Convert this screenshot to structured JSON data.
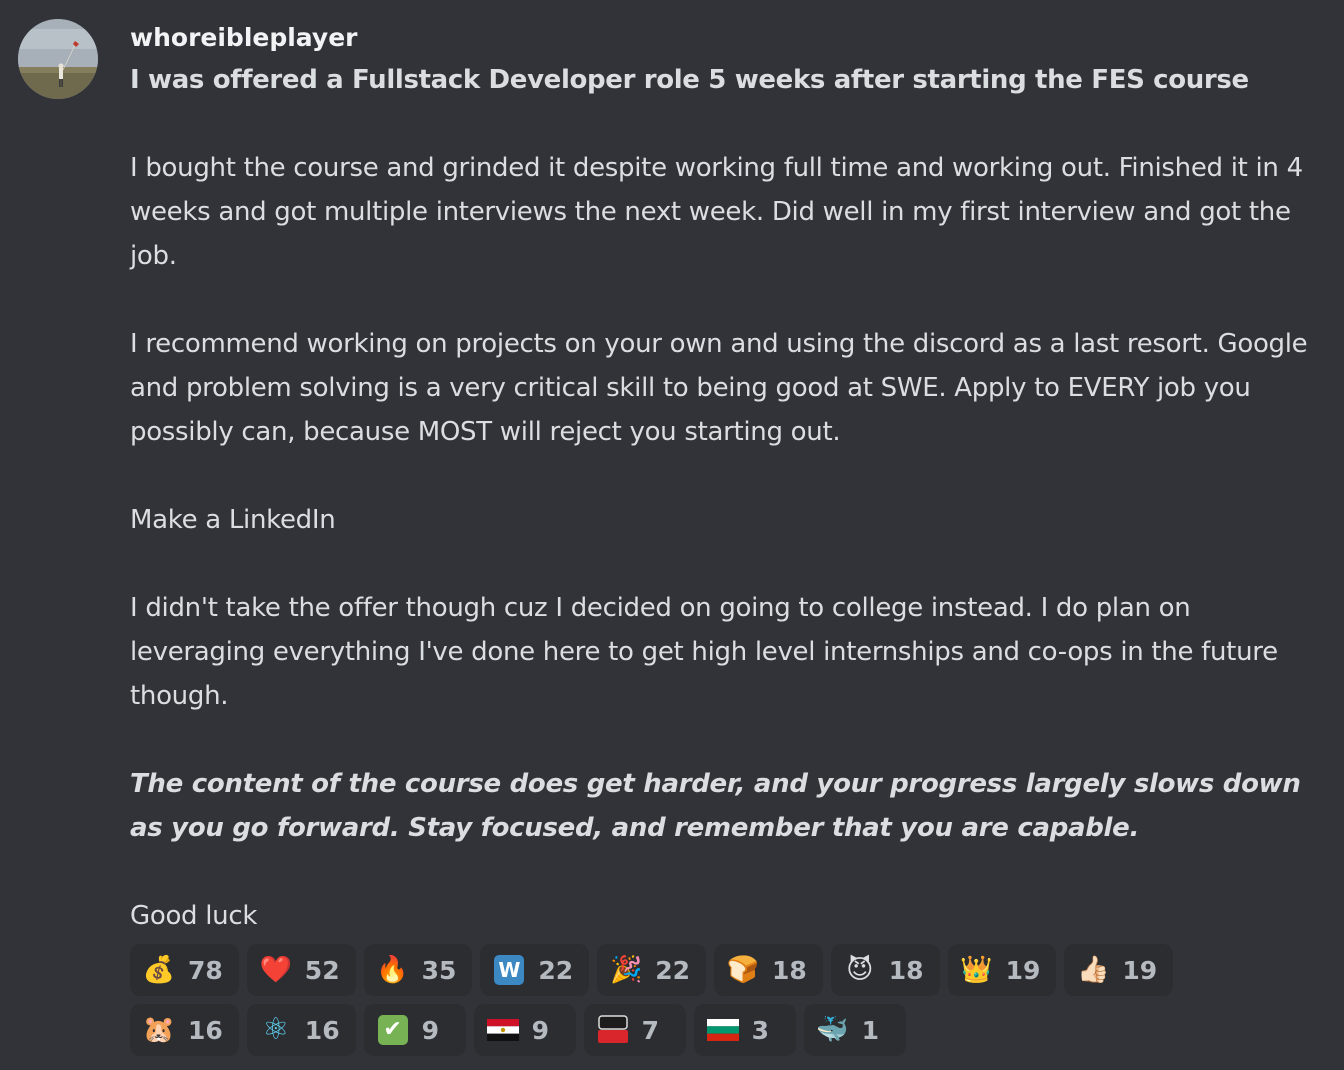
{
  "message": {
    "username": "whoreibleplayer",
    "title": "I was offered a Fullstack Developer role 5 weeks after starting the FES course",
    "paragraphs": [
      "I bought the course and grinded it despite working full time and working out. Finished it in 4 weeks and got multiple interviews the next week. Did well in my first interview and got the job.",
      "I recommend working on projects on your own and using the discord as a last resort. Google and problem solving is a very critical skill to being good at SWE. Apply to EVERY job you possibly can, because MOST will reject you starting out.",
      "Make a LinkedIn",
      "I didn't take the offer though cuz I decided on going to college instead. I do plan on leveraging everything I've done here to get high level internships and co-ops in the future though."
    ],
    "emphasis": "The content of the course does get harder, and your progress largely slows down as you go forward. Stay focused, and remember that you are capable.",
    "closing": "Good luck"
  },
  "reactions": [
    {
      "emoji": "💰",
      "icon": "money-bag-icon",
      "count": "78"
    },
    {
      "emoji": "❤️",
      "icon": "heart-icon",
      "count": "52"
    },
    {
      "emoji": "🔥",
      "icon": "fire-icon",
      "count": "35"
    },
    {
      "emoji": "W",
      "icon": "w-letter-icon",
      "count": "22"
    },
    {
      "emoji": "🎉",
      "icon": "party-popper-icon",
      "count": "22"
    },
    {
      "emoji": "🍞",
      "icon": "bread-icon",
      "count": "18"
    },
    {
      "emoji": "😈",
      "icon": "thanos-icon",
      "count": "18"
    },
    {
      "emoji": "👑",
      "icon": "crown-icon",
      "count": "19"
    },
    {
      "emoji": "👍🏻",
      "icon": "thumbs-up-icon",
      "count": "19"
    },
    {
      "emoji": "🐹",
      "icon": "sunglasses-hamster-icon",
      "count": "16"
    },
    {
      "emoji": "⚛",
      "icon": "react-logo-icon",
      "count": "16"
    },
    {
      "emoji": "✔",
      "icon": "check-mark-icon",
      "count": "9"
    },
    {
      "emoji": "🇪🇬",
      "icon": "egypt-flag-icon",
      "count": "9"
    },
    {
      "emoji": "MR HYPE",
      "icon": "mr-hype-icon",
      "count": "7"
    },
    {
      "emoji": "🇧🇬",
      "icon": "bulgaria-flag-icon",
      "count": "3"
    },
    {
      "emoji": "🐳",
      "icon": "whale-icon",
      "count": "1"
    }
  ],
  "colors": {
    "background": "#313338",
    "text": "#dbdee1",
    "username": "#f2f3f5",
    "reaction_bg": "#2b2d31",
    "w_box": "#3b88c3",
    "check_box": "#77b255"
  }
}
